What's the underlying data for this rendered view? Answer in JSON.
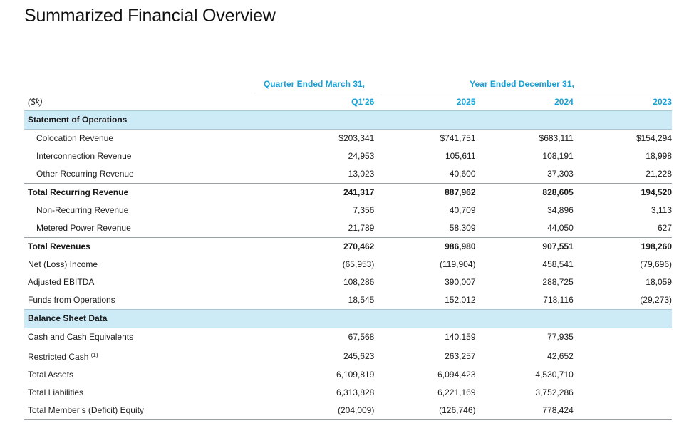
{
  "title": "Summarized Financial Overview",
  "group_headers": {
    "quarter": "Quarter Ended March 31,",
    "year": "Year Ended December 31,"
  },
  "columns": {
    "label": "($k)",
    "c1": "Q1'26",
    "c2": "2025",
    "c3": "2024",
    "c4": "2023"
  },
  "sections": {
    "operations": "Statement of Operations",
    "balance": "Balance Sheet Data"
  },
  "rows": [
    {
      "label": "Colocation Revenue",
      "v": [
        "$203,341",
        "$741,751",
        "$683,111",
        "$154,294"
      ]
    },
    {
      "label": "Interconnection Revenue",
      "v": [
        "24,953",
        "105,611",
        "108,191",
        "18,998"
      ]
    },
    {
      "label": "Other Recurring Revenue",
      "v": [
        "13,023",
        "40,600",
        "37,303",
        "21,228"
      ]
    },
    {
      "label": "Total Recurring Revenue",
      "v": [
        "241,317",
        "887,962",
        "828,605",
        "194,520"
      ]
    },
    {
      "label": "Non-Recurring Revenue",
      "v": [
        "7,356",
        "40,709",
        "34,896",
        "3,113"
      ]
    },
    {
      "label": "Metered Power Revenue",
      "v": [
        "21,789",
        "58,309",
        "44,050",
        "627"
      ]
    },
    {
      "label": "Total Revenues",
      "v": [
        "270,462",
        "986,980",
        "907,551",
        "198,260"
      ]
    },
    {
      "label": "Net (Loss) Income",
      "v": [
        "(65,953)",
        "(119,904)",
        "458,541",
        "(79,696)"
      ]
    },
    {
      "label": "Adjusted EBITDA",
      "v": [
        "108,286",
        "390,007",
        "288,725",
        "18,059"
      ]
    },
    {
      "label": "Funds from Operations",
      "v": [
        "18,545",
        "152,012",
        "718,116",
        "(29,273)"
      ]
    },
    {
      "label": "Cash and Cash Equivalents",
      "v": [
        "67,568",
        "140,159",
        "77,935",
        ""
      ]
    },
    {
      "label": "Restricted Cash",
      "note": "(1)",
      "v": [
        "245,623",
        "263,257",
        "42,652",
        ""
      ]
    },
    {
      "label": "Total Assets",
      "v": [
        "6,109,819",
        "6,094,423",
        "4,530,710",
        ""
      ]
    },
    {
      "label": "Total Liabilities",
      "v": [
        "6,313,828",
        "6,221,169",
        "3,752,286",
        ""
      ]
    },
    {
      "label": "Total Member’s (Deficit) Equity",
      "v": [
        "(204,009)",
        "(126,746)",
        "778,424",
        ""
      ]
    }
  ]
}
